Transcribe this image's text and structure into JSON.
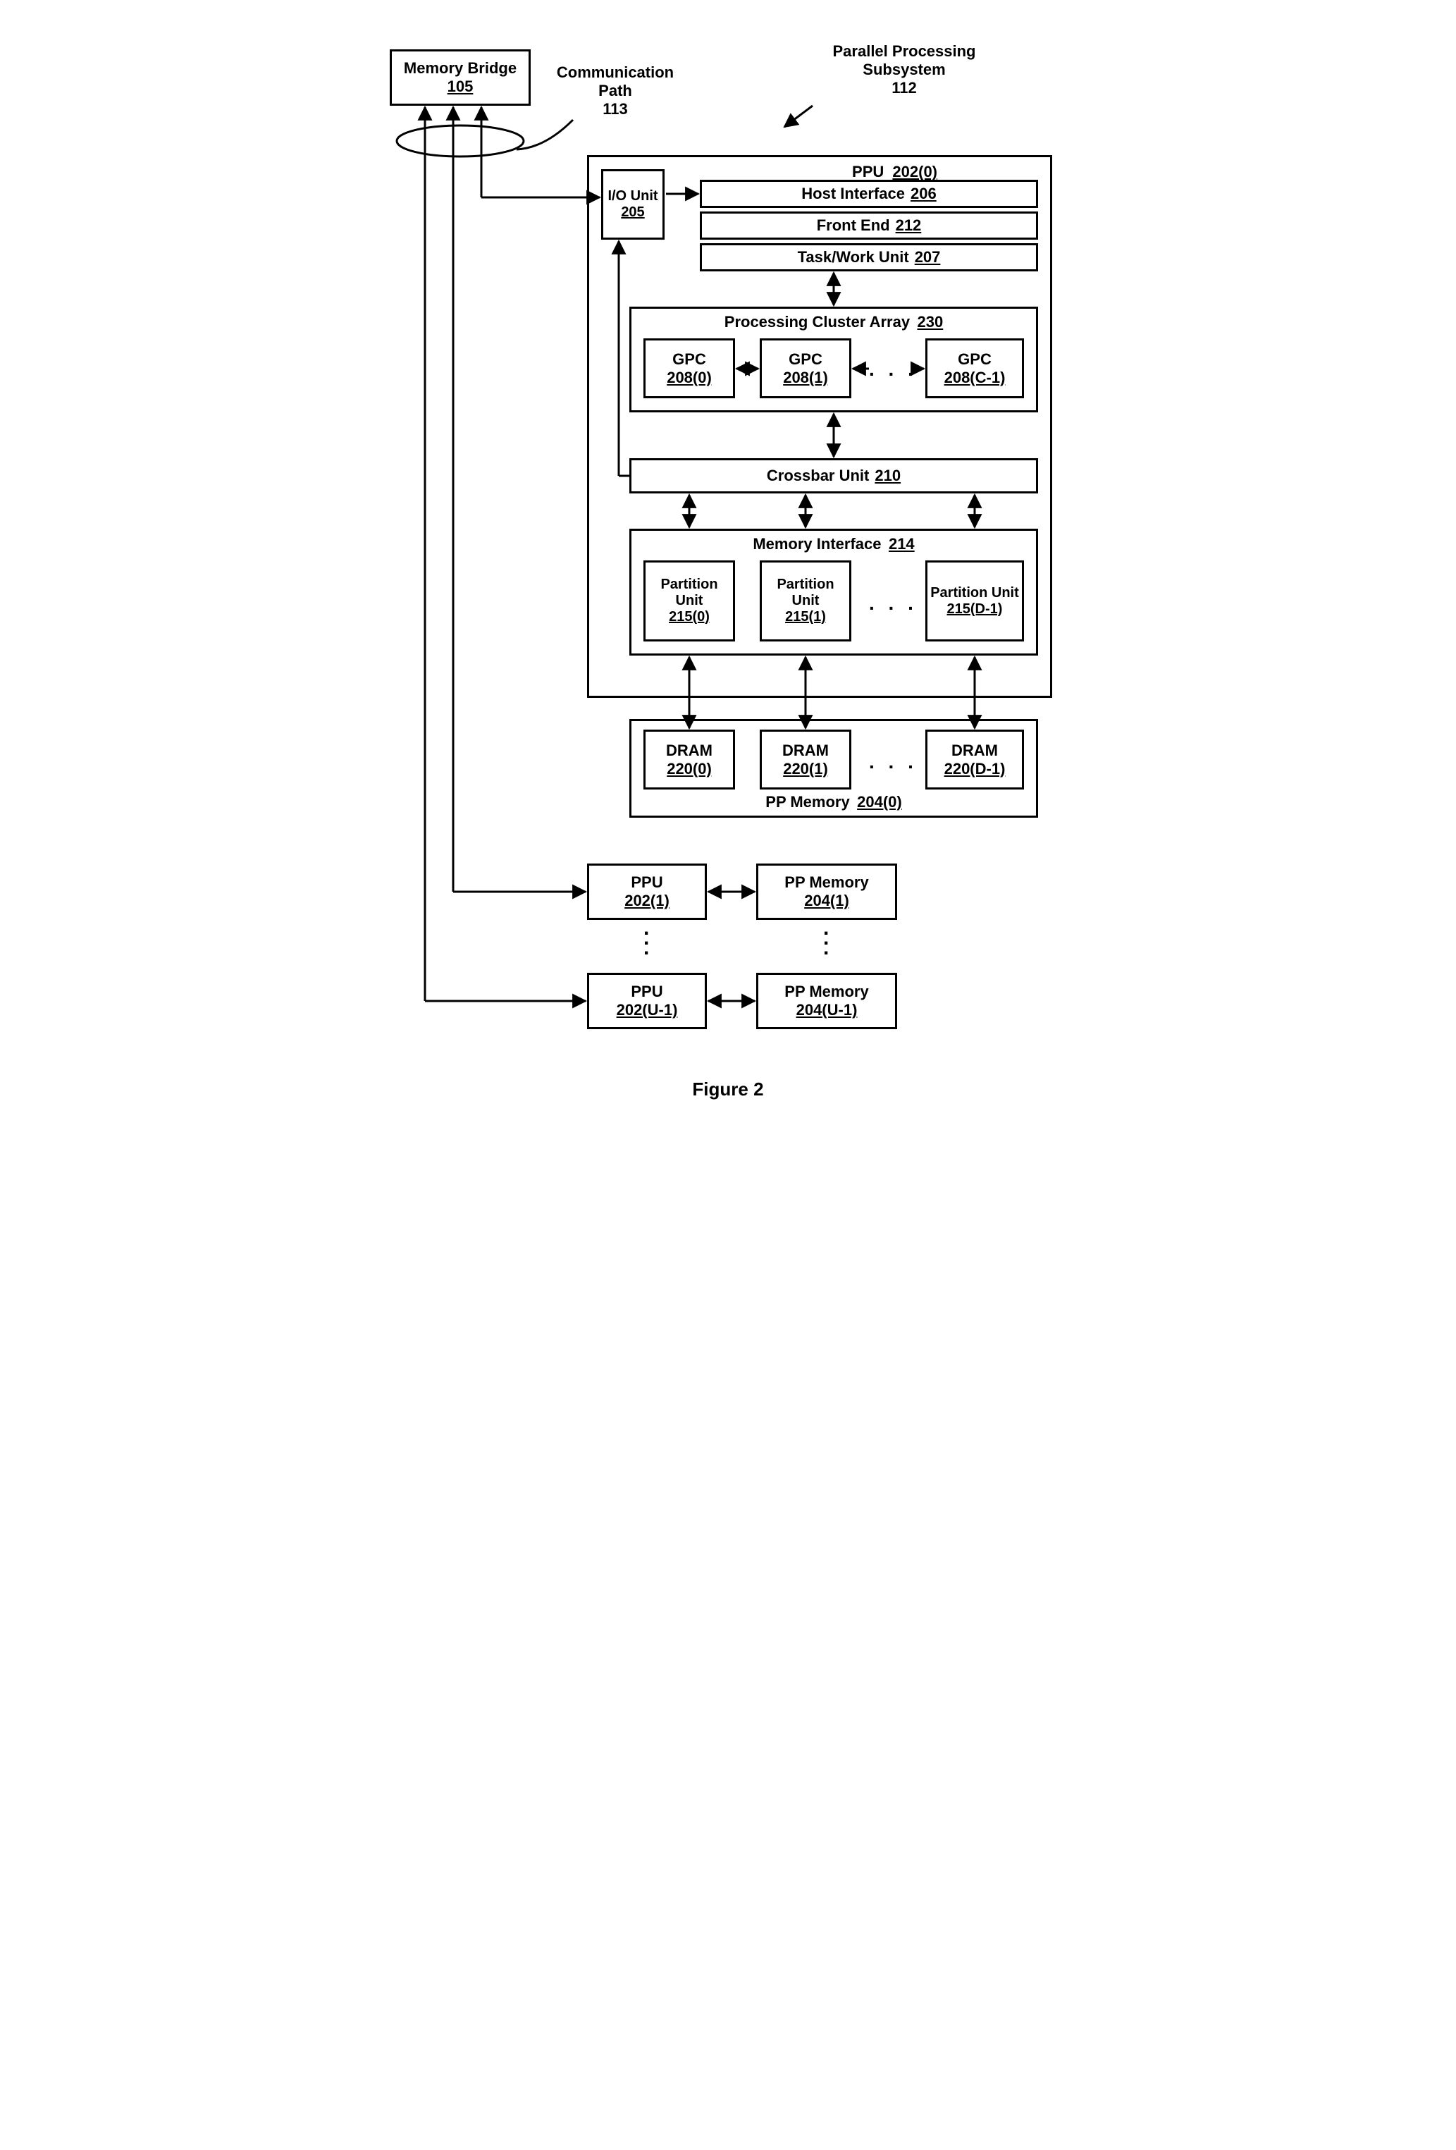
{
  "title_block": {
    "memory_bridge": {
      "label": "Memory Bridge",
      "ref": "105"
    },
    "comm_path": {
      "label": "Communication Path",
      "ref": "113"
    },
    "subsystem": {
      "label": "Parallel Processing Subsystem",
      "ref": "112"
    }
  },
  "ppu0": {
    "title": "PPU",
    "ref": "202(0)",
    "io_unit": {
      "label": "I/O Unit",
      "ref": "205"
    },
    "host_if": {
      "label": "Host Interface",
      "ref": "206"
    },
    "front_end": {
      "label": "Front End",
      "ref": "212"
    },
    "task_unit": {
      "label": "Task/Work Unit",
      "ref": "207"
    },
    "pca": {
      "title": "Processing Cluster Array",
      "ref": "230",
      "gpc0": {
        "label": "GPC",
        "ref": "208(0)"
      },
      "gpc1": {
        "label": "GPC",
        "ref": "208(1)"
      },
      "gpcC": {
        "label": "GPC",
        "ref": "208(C-1)"
      }
    },
    "crossbar": {
      "label": "Crossbar Unit",
      "ref": "210"
    },
    "mi": {
      "title": "Memory Interface",
      "ref": "214",
      "pu0": {
        "label": "Partition Unit",
        "ref": "215(0)"
      },
      "pu1": {
        "label": "Partition Unit",
        "ref": "215(1)"
      },
      "puD": {
        "label": "Partition Unit",
        "ref": "215(D-1)"
      }
    }
  },
  "ppmem0": {
    "title": "PP Memory",
    "ref": "204(0)",
    "dram0": {
      "label": "DRAM",
      "ref": "220(0)"
    },
    "dram1": {
      "label": "DRAM",
      "ref": "220(1)"
    },
    "dramD": {
      "label": "DRAM",
      "ref": "220(D-1)"
    }
  },
  "ppu1": {
    "label": "PPU",
    "ref": "202(1)"
  },
  "ppmem1": {
    "label": "PP Memory",
    "ref": "204(1)"
  },
  "ppuU": {
    "label": "PPU",
    "ref": "202(U-1)"
  },
  "ppmemU": {
    "label": "PP Memory",
    "ref": "204(U-1)"
  },
  "figure": "Figure 2",
  "ellipsis": ". . ."
}
